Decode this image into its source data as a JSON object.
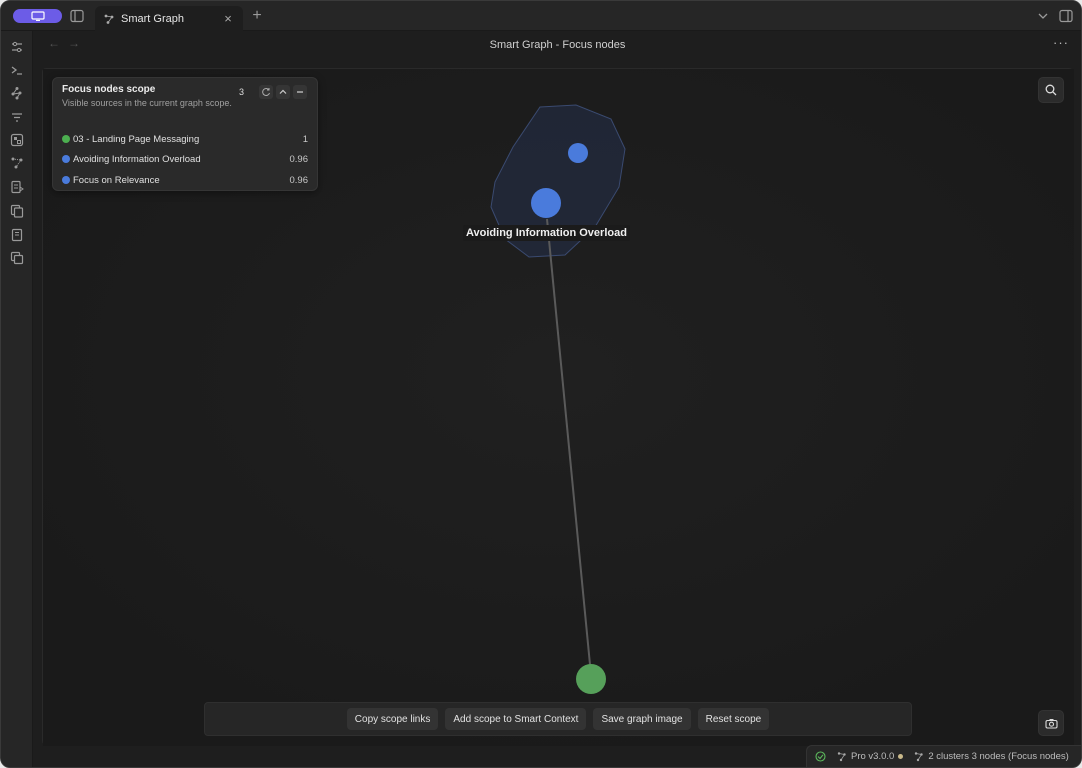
{
  "window": {
    "tab": {
      "title": "Smart Graph"
    },
    "view_title": "Smart Graph - Focus nodes"
  },
  "scope_panel": {
    "title": "Focus nodes scope",
    "description": "Visible sources in the current graph scope.",
    "count": "3",
    "items": [
      {
        "label": "03 - Landing Page Messaging",
        "score": "1",
        "color": "#4caf50"
      },
      {
        "label": "Avoiding Information Overload",
        "score": "0.96",
        "color": "#4a7bdc"
      },
      {
        "label": "Focus on Relevance",
        "score": "0.96",
        "color": "#4a7bdc"
      }
    ]
  },
  "graph": {
    "focused_node_label": "Avoiding Information Overload",
    "colors": {
      "cluster_node": "#4a7bdc",
      "source_node": "#56a05a",
      "hull": "#2a3550",
      "edge": "#5a5a5a"
    }
  },
  "toolbar": {
    "copy_scope_links": "Copy scope links",
    "add_scope": "Add scope to Smart Context",
    "save_graph_image": "Save graph image",
    "reset_scope": "Reset scope"
  },
  "statusbar": {
    "version": "Pro v3.0.0",
    "clusters": "2 clusters 3 nodes (Focus nodes)"
  },
  "icons": {
    "ribbon": [
      "sliders-icon",
      "terminal-icon",
      "graph-icon",
      "filter-icon",
      "canvas-icon",
      "smart-graph-icon",
      "note-icon",
      "copy-icon",
      "book-icon",
      "layers-icon"
    ]
  }
}
